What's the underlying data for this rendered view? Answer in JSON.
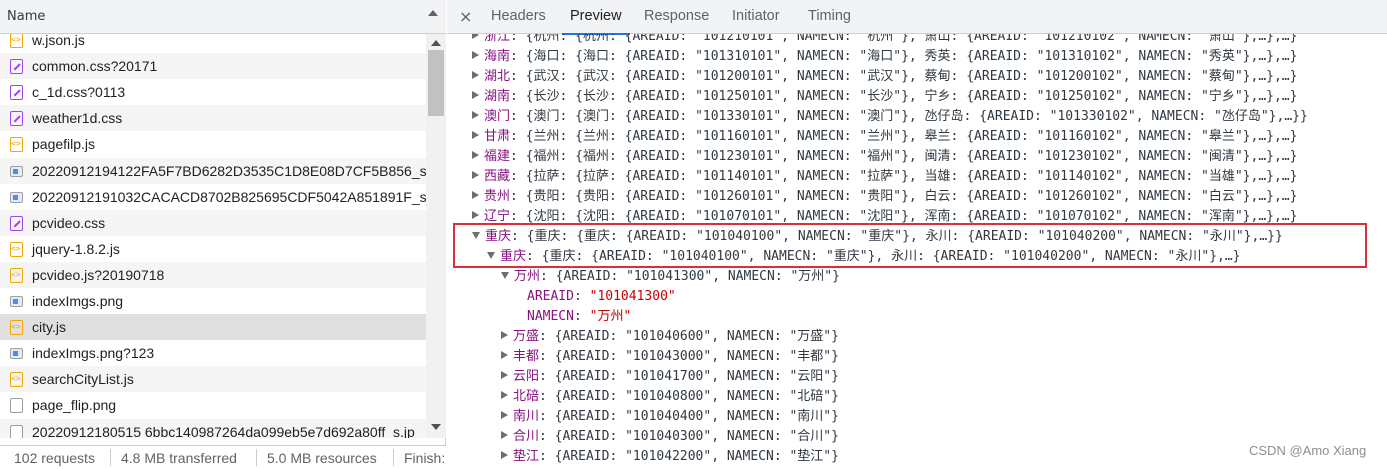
{
  "left": {
    "header_label": "Name",
    "files": [
      {
        "name": "w.json.js",
        "icon": "js-file-icon",
        "kind": "js"
      },
      {
        "name": "common.css?20171",
        "icon": "css-file-icon",
        "kind": "css"
      },
      {
        "name": "c_1d.css?0113",
        "icon": "css-file-icon",
        "kind": "css"
      },
      {
        "name": "weather1d.css",
        "icon": "css-file-icon",
        "kind": "css"
      },
      {
        "name": "pagefilp.js",
        "icon": "js-file-icon",
        "kind": "js"
      },
      {
        "name": "20220912194122FA5F7BD6282D3535C1D8E08D7CF5B856_s",
        "icon": "image-file-icon",
        "kind": "img"
      },
      {
        "name": "20220912191032CACACD8702B825695CDF5042A851891F_s",
        "icon": "image-file-icon",
        "kind": "img"
      },
      {
        "name": "pcvideo.css",
        "icon": "css-file-icon",
        "kind": "css"
      },
      {
        "name": "jquery-1.8.2.js",
        "icon": "js-file-icon",
        "kind": "js"
      },
      {
        "name": "pcvideo.js?20190718",
        "icon": "js-file-icon",
        "kind": "js"
      },
      {
        "name": "indexImgs.png",
        "icon": "image-file-icon",
        "kind": "img"
      },
      {
        "name": "city.js",
        "icon": "js-file-icon",
        "kind": "js"
      },
      {
        "name": "indexImgs.png?123",
        "icon": "image-file-icon",
        "kind": "img"
      },
      {
        "name": "searchCityList.js",
        "icon": "js-file-icon",
        "kind": "js"
      },
      {
        "name": "page_flip.png",
        "icon": "doc-file-icon",
        "kind": "doc"
      },
      {
        "name": "20220912180515 6bbc140987264da099eb5e7d692a80ff_s.jp",
        "icon": "doc-file-icon",
        "kind": "doc"
      }
    ],
    "selected_index": 11,
    "status": {
      "requests": "102 requests",
      "transferred": "4.8 MB transferred",
      "resources": "5.0 MB resources",
      "finish": "Finish:"
    }
  },
  "right": {
    "close_label": "×",
    "tabs": [
      "Headers",
      "Preview",
      "Response",
      "Initiator",
      "Timing"
    ],
    "active_tab": "Preview",
    "preview_lines": [
      {
        "indent": 0,
        "toggle": "r",
        "key": "浙江",
        "text": ": {杭州: {杭州: {AREAID: \"101210101\", NAMECN: \"杭州\"}, 萧山: {AREAID: \"101210102\", NAMECN: \"萧山\"},…},…}"
      },
      {
        "indent": 0,
        "toggle": "r",
        "key": "海南",
        "text": ": {海口: {海口: {AREAID: \"101310101\", NAMECN: \"海口\"}, 秀英: {AREAID: \"101310102\", NAMECN: \"秀英\"},…},…}"
      },
      {
        "indent": 0,
        "toggle": "r",
        "key": "湖北",
        "text": ": {武汉: {武汉: {AREAID: \"101200101\", NAMECN: \"武汉\"}, 蔡甸: {AREAID: \"101200102\", NAMECN: \"蔡甸\"},…},…}"
      },
      {
        "indent": 0,
        "toggle": "r",
        "key": "湖南",
        "text": ": {长沙: {长沙: {AREAID: \"101250101\", NAMECN: \"长沙\"}, 宁乡: {AREAID: \"101250102\", NAMECN: \"宁乡\"},…},…}"
      },
      {
        "indent": 0,
        "toggle": "r",
        "key": "澳门",
        "text": ": {澳门: {澳门: {AREAID: \"101330101\", NAMECN: \"澳门\"}, 氹仔岛: {AREAID: \"101330102\", NAMECN: \"氹仔岛\"},…}}"
      },
      {
        "indent": 0,
        "toggle": "r",
        "key": "甘肃",
        "text": ": {兰州: {兰州: {AREAID: \"101160101\", NAMECN: \"兰州\"}, 皋兰: {AREAID: \"101160102\", NAMECN: \"皋兰\"},…},…}"
      },
      {
        "indent": 0,
        "toggle": "r",
        "key": "福建",
        "text": ": {福州: {福州: {AREAID: \"101230101\", NAMECN: \"福州\"}, 闽清: {AREAID: \"101230102\", NAMECN: \"闽清\"},…},…}"
      },
      {
        "indent": 0,
        "toggle": "r",
        "key": "西藏",
        "text": ": {拉萨: {拉萨: {AREAID: \"101140101\", NAMECN: \"拉萨\"}, 当雄: {AREAID: \"101140102\", NAMECN: \"当雄\"},…},…}"
      },
      {
        "indent": 0,
        "toggle": "r",
        "key": "贵州",
        "text": ": {贵阳: {贵阳: {AREAID: \"101260101\", NAMECN: \"贵阳\"}, 白云: {AREAID: \"101260102\", NAMECN: \"白云\"},…},…}"
      },
      {
        "indent": 0,
        "toggle": "r",
        "key": "辽宁",
        "text": ": {沈阳: {沈阳: {AREAID: \"101070101\", NAMECN: \"沈阳\"}, 浑南: {AREAID: \"101070102\", NAMECN: \"浑南\"},…},…}"
      },
      {
        "indent": 0,
        "toggle": "d",
        "key": "重庆",
        "text": ": {重庆: {重庆: {AREAID: \"101040100\", NAMECN: \"重庆\"}, 永川: {AREAID: \"101040200\", NAMECN: \"永川\"},…}}"
      },
      {
        "indent": 1,
        "toggle": "d",
        "key": "重庆",
        "text": ": {重庆: {AREAID: \"101040100\", NAMECN: \"重庆\"}, 永川: {AREAID: \"101040200\", NAMECN: \"永川\"},…}"
      },
      {
        "indent": 2,
        "toggle": "d",
        "key": "万州",
        "text": ": {AREAID: \"101041300\", NAMECN: \"万州\"}"
      },
      {
        "indent": 3,
        "toggle": "",
        "key": "AREAID",
        "value": "\"101041300\""
      },
      {
        "indent": 3,
        "toggle": "",
        "key": "NAMECN",
        "value": "\"万州\""
      },
      {
        "indent": 2,
        "toggle": "r",
        "key": "万盛",
        "text": ": {AREAID: \"101040600\", NAMECN: \"万盛\"}"
      },
      {
        "indent": 2,
        "toggle": "r",
        "key": "丰都",
        "text": ": {AREAID: \"101043000\", NAMECN: \"丰都\"}"
      },
      {
        "indent": 2,
        "toggle": "r",
        "key": "云阳",
        "text": ": {AREAID: \"101041700\", NAMECN: \"云阳\"}"
      },
      {
        "indent": 2,
        "toggle": "r",
        "key": "北碚",
        "text": ": {AREAID: \"101040800\", NAMECN: \"北碚\"}"
      },
      {
        "indent": 2,
        "toggle": "r",
        "key": "南川",
        "text": ": {AREAID: \"101040400\", NAMECN: \"南川\"}"
      },
      {
        "indent": 2,
        "toggle": "r",
        "key": "合川",
        "text": ": {AREAID: \"101040300\", NAMECN: \"合川\"}"
      },
      {
        "indent": 2,
        "toggle": "r",
        "key": "垫江",
        "text": ": {AREAID: \"101042200\", NAMECN: \"垫江\"}"
      }
    ],
    "watermark": "CSDN @Amo Xiang"
  },
  "colors": {
    "highlight_box": "#d9303a",
    "key_purple": "#881280",
    "value_red": "#c80000",
    "tab_accent": "#1a73e8"
  }
}
